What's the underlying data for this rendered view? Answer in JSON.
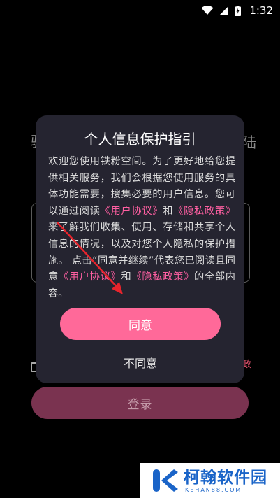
{
  "status_bar": {
    "time": "1:32",
    "icons": [
      "wifi-icon",
      "signal-icon",
      "battery-charging-icon"
    ]
  },
  "background": {
    "title_left_fragment": "驱",
    "title_right_fragment": "陆",
    "agree_tail_fragment": "政",
    "login_label": "登录"
  },
  "dialog": {
    "title": "个人信息保护指引",
    "body_intro": "欢迎您使用铁粉空间。为了更好地给您提供相关服务，我们会根据您使用服务的具体功能需要，搜集必要的用户信息。您可以通过阅读",
    "link_user_agreement": "《用户协议》",
    "and_1": "和",
    "link_privacy_policy": "《隐私政策》",
    "body_mid": "来了解我们收集、使用、存储和共享个人信息的情况，以及对您个人隐私的保护措施。 点击“同意并继续”代表您已阅读且同意",
    "link_user_agreement_2": "《用户协议》",
    "and_2": "和",
    "link_privacy_policy_2": "《隐私政策》",
    "body_end": "的全部内容。",
    "agree_label": "同意",
    "disagree_label": "不同意"
  },
  "watermark": {
    "name": "柯翰软件园",
    "domain": "KEHAN88.COM"
  },
  "colors": {
    "accent_pink": "#ff6999",
    "link_pink": "#ff5fa2",
    "dialog_bg": "#252430",
    "login_disabled": "#7a3350"
  }
}
